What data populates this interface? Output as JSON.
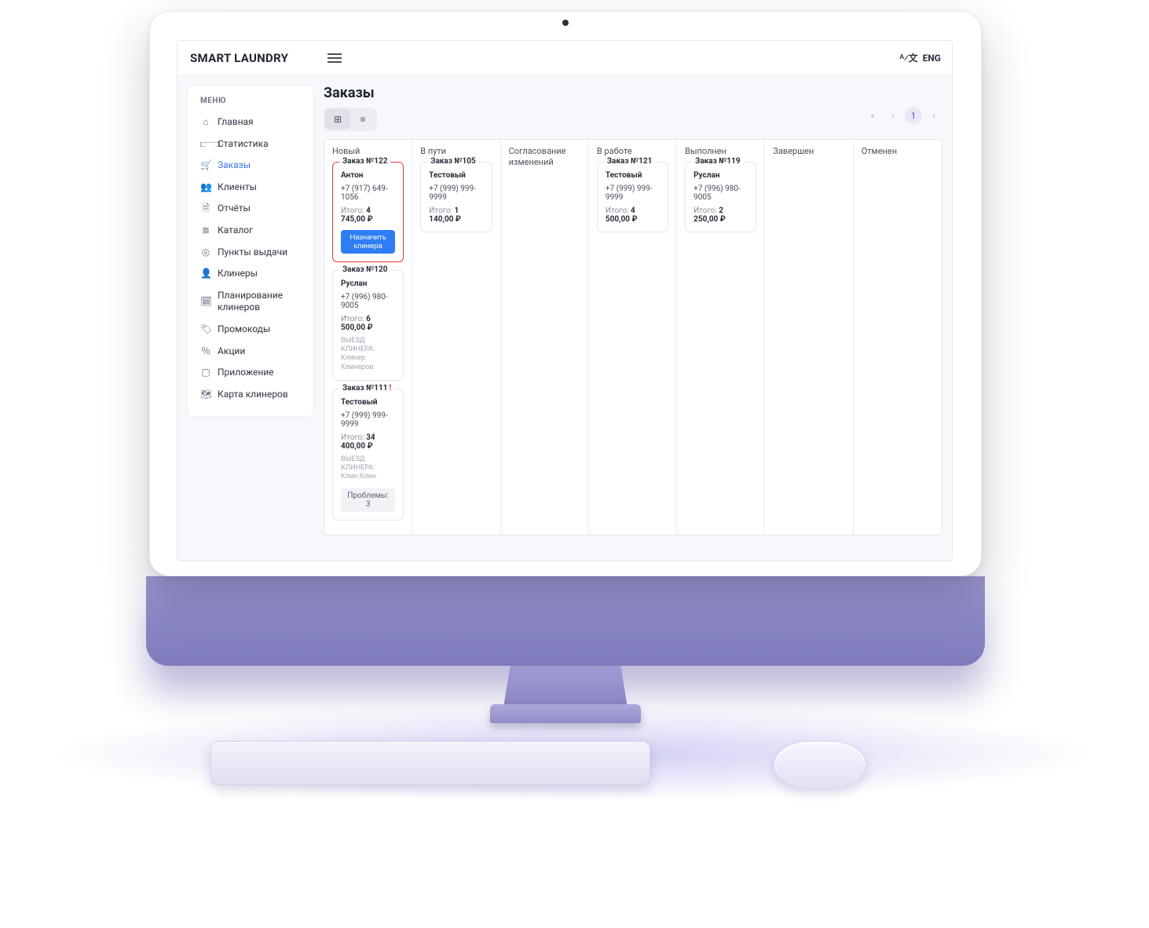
{
  "brand": "SMART LAUNDRY",
  "lang_label": "ENG",
  "sidebar": {
    "title": "МЕНЮ",
    "items": [
      {
        "icon": "⌂",
        "label": "Главная"
      },
      {
        "icon": "⫍⫎",
        "label": "Статистика"
      },
      {
        "icon": "🛒",
        "label": "Заказы"
      },
      {
        "icon": "👥",
        "label": "Клиенты"
      },
      {
        "icon": "🗎",
        "label": "Отчёты"
      },
      {
        "icon": "≣",
        "label": "Каталог"
      },
      {
        "icon": "◎",
        "label": "Пункты выдачи"
      },
      {
        "icon": "👤",
        "label": "Клинеры"
      },
      {
        "icon": "🗓",
        "label": "Планирование клинеров"
      },
      {
        "icon": "🏷",
        "label": "Промокоды"
      },
      {
        "icon": "％",
        "label": "Акции"
      },
      {
        "icon": "▢",
        "label": "Приложение"
      },
      {
        "icon": "🗺",
        "label": "Карта клинеров"
      }
    ],
    "active_index": 2
  },
  "page": {
    "title": "Заказы",
    "view": {
      "grid_icon": "⊞",
      "list_icon": "≡"
    },
    "pager": {
      "first": "«",
      "prev": "‹",
      "page": "1",
      "next": "›"
    }
  },
  "columns": [
    {
      "title": "Новый"
    },
    {
      "title": "В пути"
    },
    {
      "title": "Согласование изменений"
    },
    {
      "title": "В работе"
    },
    {
      "title": "Выполнен"
    },
    {
      "title": "Завершен"
    },
    {
      "title": "Отменен"
    }
  ],
  "cards": {
    "new": [
      {
        "legend": "Заказ №122",
        "name": "Антон",
        "phone": "+7 (917) 649-1056",
        "total_label": "Итого:",
        "total": "4 745,00 ₽",
        "assign": "Назначить клинера",
        "red": true
      },
      {
        "legend": "Заказ №120",
        "name": "Руслан",
        "phone": "+7 (996) 980-9005",
        "total_label": "Итого:",
        "total": "6 500,00 ₽",
        "meta_t": "ВЫЕЗД КЛИНЕРА:",
        "meta_v": "Клинер Клинеров"
      },
      {
        "legend": "Заказ №111",
        "legend_warn": "!",
        "name": "Тестовый",
        "phone": "+7 (999) 999-9999",
        "total_label": "Итого:",
        "total": "34 400,00 ₽",
        "meta_t": "ВЫЕЗД КЛИНЕРА:",
        "meta_v": "Клин Клин",
        "problems": "Проблемы: 3"
      }
    ],
    "transit": [
      {
        "legend": "Заказ №105",
        "name": "Тестовый",
        "phone": "+7 (999) 999-9999",
        "total_label": "Итого:",
        "total": "1 140,00 ₽"
      }
    ],
    "inwork": [
      {
        "legend": "Заказ №121",
        "name": "Тестовый",
        "phone": "+7 (999) 999-9999",
        "total_label": "Итого:",
        "total": "4 500,00 ₽"
      }
    ],
    "done": [
      {
        "legend": "Заказ №119",
        "name": "Руслан",
        "phone": "+7 (996) 980-9005",
        "total_label": "Итого:",
        "total": "2 250,00 ₽"
      }
    ]
  }
}
